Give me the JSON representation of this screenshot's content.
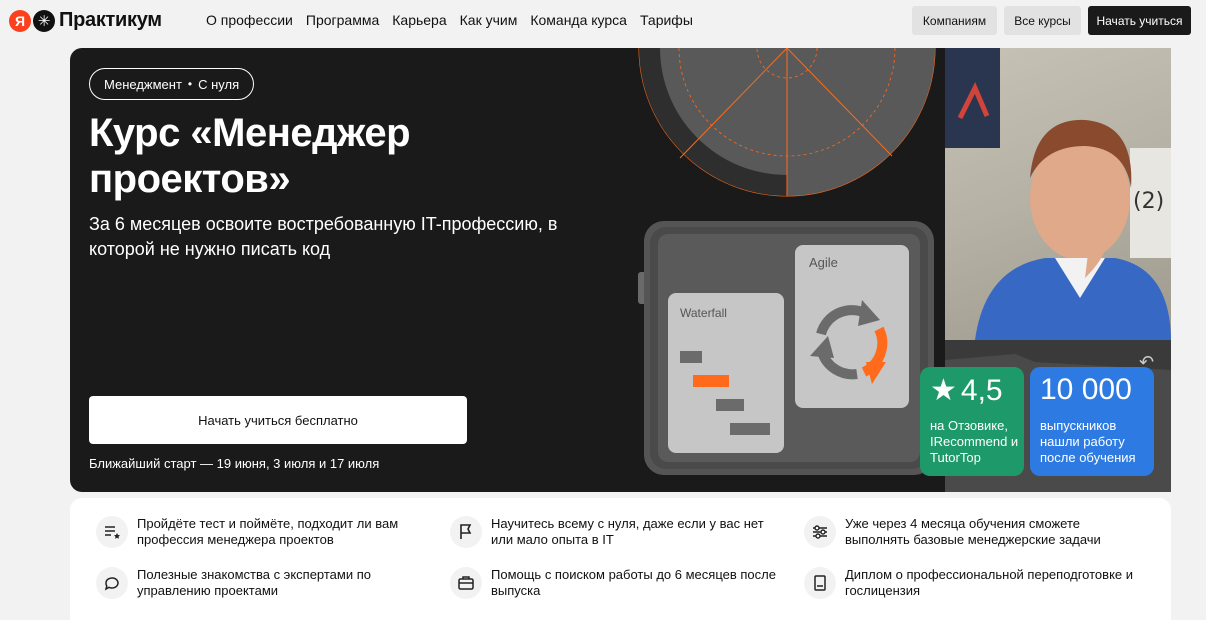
{
  "header": {
    "logo_letter": "Я",
    "logo_text": "Практикум",
    "nav": [
      "О профессии",
      "Программа",
      "Карьера",
      "Как учим",
      "Команда курса",
      "Тарифы"
    ],
    "btn_companies": "Компаниям",
    "btn_all_courses": "Все курсы",
    "btn_start": "Начать учиться"
  },
  "hero": {
    "tag_category": "Менеджмент",
    "tag_level": "С нуля",
    "title": "Курс «Менеджер проектов»",
    "subtitle": "За 6 месяцев освоите востребованную IT-профессию, в которой не нужно писать код",
    "cta": "Начать учиться бесплатно",
    "next_start": "Ближайший старт — 19 июня, 3 июля и 17 июля",
    "card_waterfall": "Waterfall",
    "card_agile": "Agile",
    "rating_value": "4,5",
    "rating_caption": "на Отзовике, IRecommend и TutorTop",
    "graduates_value": "10 000",
    "graduates_caption": "выпускников нашли работу после обучения"
  },
  "features": [
    {
      "icon": "list-star-icon",
      "text": "Пройдёте тест и поймёте, подходит ли вам профессия менеджера проектов"
    },
    {
      "icon": "flag-icon",
      "text": "Научитесь всему с нуля, даже если у вас нет или мало опыта в IT"
    },
    {
      "icon": "sliders-icon",
      "text": "Уже через 4 месяца обучения сможете выполнять базовые менеджерские задачи"
    },
    {
      "icon": "chat-icon",
      "text": "Полезные знакомства с экспертами по управлению проектами"
    },
    {
      "icon": "briefcase-icon",
      "text": "Помощь с поиском работы до 6 месяцев после выпуска"
    },
    {
      "icon": "book-icon",
      "text": "Диплом о профессиональной переподготовке и гослицензия"
    }
  ],
  "colors": {
    "accent_orange": "#ff6b1a",
    "rating_green": "#1e9a6a",
    "graduates_blue": "#2d7be2",
    "hero_dark": "#1a1a1a"
  }
}
